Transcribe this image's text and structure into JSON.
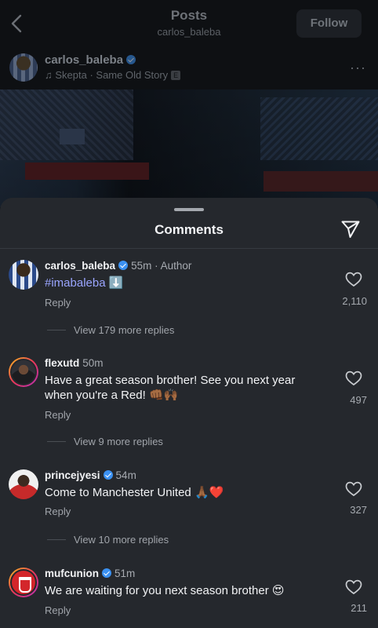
{
  "header": {
    "title": "Posts",
    "subtitle": "carlos_baleba",
    "follow_label": "Follow"
  },
  "post": {
    "username": "carlos_baleba",
    "music": "Skepta · Same Old Story",
    "explicit_badge": "E",
    "more": "···"
  },
  "comments_sheet": {
    "title": "Comments"
  },
  "comments": [
    {
      "username": "carlos_baleba",
      "verified": true,
      "time": "55m · Author",
      "text": "#imabaleba",
      "emoji": "⬇️",
      "reply_label": "Reply",
      "likes": "2,110",
      "more_replies": "View 179 more replies"
    },
    {
      "username": "flexutd",
      "verified": false,
      "time": "50m",
      "text": "Have a great season brother! See you next year when you're a Red!",
      "emoji": "👊🏾🙌🏾",
      "reply_label": "Reply",
      "likes": "497",
      "more_replies": "View 9 more replies"
    },
    {
      "username": "princejyesi",
      "verified": true,
      "time": "54m",
      "text": "Come to Manchester United",
      "emoji": "🙏🏾❤️",
      "reply_label": "Reply",
      "likes": "327",
      "more_replies": "View 10 more replies"
    },
    {
      "username": "mufcunion",
      "verified": true,
      "time": "51m",
      "text": "We are waiting for you next season brother",
      "emoji": "😍",
      "reply_label": "Reply",
      "likes": "211"
    }
  ],
  "colors": {
    "sheet_bg": "#25282d",
    "hashtag": "#9aa5ff",
    "verified": "#3b91f2"
  }
}
